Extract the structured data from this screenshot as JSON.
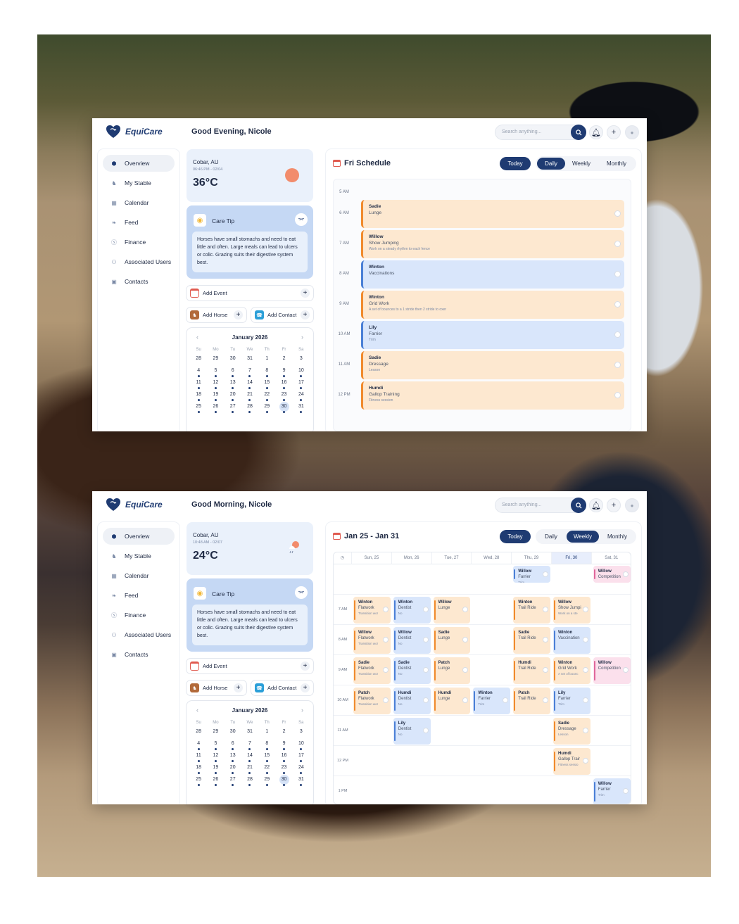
{
  "brand": {
    "name": "EquiCare"
  },
  "search": {
    "placeholder": "Search anything..."
  },
  "nav": [
    "Overview",
    "My Stable",
    "Calendar",
    "Feed",
    "Finance",
    "Associated Users",
    "Contacts"
  ],
  "care_tip": {
    "title": "Care Tip",
    "text": "Horses have small stomachs and need to eat little and often. Large meals can lead to ulcers or colic. Grazing suits their digestive system best."
  },
  "quick": {
    "add_event": "Add Event",
    "add_horse": "Add Horse",
    "add_contact": "Add Contact"
  },
  "mini_calendar": {
    "month": "January 2026",
    "weekdays": [
      "Su",
      "Mo",
      "Tu",
      "We",
      "Th",
      "Fr",
      "Sa"
    ],
    "days": [
      "28",
      "29",
      "30",
      "31",
      "1",
      "2",
      "3",
      "4",
      "5",
      "6",
      "7",
      "8",
      "9",
      "10",
      "11",
      "12",
      "13",
      "14",
      "15",
      "16",
      "17",
      "18",
      "19",
      "20",
      "21",
      "22",
      "23",
      "24",
      "25",
      "26",
      "27",
      "28",
      "29",
      "30",
      "31"
    ]
  },
  "view_buttons": {
    "today": "Today",
    "daily": "Daily",
    "weekly": "Weekly",
    "monthly": "Monthly"
  },
  "screen1": {
    "greeting": "Good Evening, Nicole",
    "weather": {
      "location": "Cobar, AU",
      "time": "06:46 PM - 02/04",
      "temp": "36°C"
    },
    "schedule_title": "Fri Schedule",
    "first_time": "5 AM",
    "events": [
      {
        "time": "6 AM",
        "name": "Sadie",
        "type": "Lunge",
        "note": "",
        "color": "orange"
      },
      {
        "time": "7 AM",
        "name": "Willow",
        "type": "Show Jumping",
        "note": "Work on a steady rhythm to each fence",
        "color": "orange"
      },
      {
        "time": "8 AM",
        "name": "Winton",
        "type": "Vaccinations",
        "note": "",
        "color": "blue"
      },
      {
        "time": "9 AM",
        "name": "Winton",
        "type": "Grid Work",
        "note": "A set of bounces to a 1 stride then 2 stride to oxer",
        "color": "orange"
      },
      {
        "time": "10 AM",
        "name": "Lily",
        "type": "Farrier",
        "note": "Trim",
        "color": "blue"
      },
      {
        "time": "11 AM",
        "name": "Sadie",
        "type": "Dressage",
        "note": "Lesson",
        "color": "orange"
      },
      {
        "time": "12 PM",
        "name": "Humdi",
        "type": "Gallop Training",
        "note": "Fitness session",
        "color": "orange"
      }
    ]
  },
  "screen2": {
    "greeting": "Good Morning, Nicole",
    "weather": {
      "location": "Cobar, AU",
      "time": "10:48 AM - 02/07",
      "temp": "24°C"
    },
    "schedule_title": "Jan 25 - Jan 31",
    "days": [
      "Sun, 25",
      "Mon, 26",
      "Tue, 27",
      "Wed, 28",
      "Thu, 29",
      "Fri, 30",
      "Sat, 31"
    ],
    "times": [
      "7 AM",
      "8 AM",
      "9 AM",
      "10 AM",
      "11 AM",
      "12 PM",
      "1 PM"
    ],
    "events": [
      {
        "row": 0,
        "col": 4,
        "name": "Willow",
        "type": "Farrier",
        "note": "Trim",
        "color": "blue"
      },
      {
        "row": 0,
        "col": 6,
        "name": "Willow",
        "type": "Competition",
        "note": "",
        "color": "pink"
      },
      {
        "row": 1,
        "col": 0,
        "name": "Winton",
        "type": "Flatwork",
        "note": "Transition wor",
        "color": "orange"
      },
      {
        "row": 1,
        "col": 1,
        "name": "Winton",
        "type": "Dentist",
        "note": "No",
        "color": "blue"
      },
      {
        "row": 1,
        "col": 2,
        "name": "Willow",
        "type": "Lunge",
        "note": "",
        "color": "orange"
      },
      {
        "row": 1,
        "col": 4,
        "name": "Winton",
        "type": "Trail Ride",
        "note": "",
        "color": "orange"
      },
      {
        "row": 1,
        "col": 5,
        "name": "Willow",
        "type": "Show Jumpi",
        "note": "Work on a ste",
        "color": "orange"
      },
      {
        "row": 2,
        "col": 0,
        "name": "Willow",
        "type": "Flatwork",
        "note": "Transition wor",
        "color": "orange"
      },
      {
        "row": 2,
        "col": 1,
        "name": "Willow",
        "type": "Dentist",
        "note": "No",
        "color": "blue"
      },
      {
        "row": 2,
        "col": 2,
        "name": "Sadie",
        "type": "Lunge",
        "note": "",
        "color": "orange"
      },
      {
        "row": 2,
        "col": 4,
        "name": "Sadie",
        "type": "Trail Ride",
        "note": "",
        "color": "orange"
      },
      {
        "row": 2,
        "col": 5,
        "name": "Winton",
        "type": "Vaccination",
        "note": "",
        "color": "blue"
      },
      {
        "row": 3,
        "col": 0,
        "name": "Sadie",
        "type": "Flatwork",
        "note": "Transition wor",
        "color": "orange"
      },
      {
        "row": 3,
        "col": 1,
        "name": "Sadie",
        "type": "Dentist",
        "note": "No",
        "color": "blue"
      },
      {
        "row": 3,
        "col": 2,
        "name": "Patch",
        "type": "Lunge",
        "note": "",
        "color": "orange"
      },
      {
        "row": 3,
        "col": 4,
        "name": "Humdi",
        "type": "Trail Ride",
        "note": "",
        "color": "orange"
      },
      {
        "row": 3,
        "col": 5,
        "name": "Winton",
        "type": "Grid Work",
        "note": "A set of bounc",
        "color": "orange"
      },
      {
        "row": 3,
        "col": 6,
        "name": "Willow",
        "type": "Competition",
        "note": "",
        "color": "pink"
      },
      {
        "row": 4,
        "col": 0,
        "name": "Patch",
        "type": "Flatwork",
        "note": "Transition wor",
        "color": "orange"
      },
      {
        "row": 4,
        "col": 1,
        "name": "Humdi",
        "type": "Dentist",
        "note": "No",
        "color": "blue"
      },
      {
        "row": 4,
        "col": 2,
        "name": "Humdi",
        "type": "Lunge",
        "note": "",
        "color": "orange"
      },
      {
        "row": 4,
        "col": 3,
        "name": "Winton",
        "type": "Farrier",
        "note": "Trim",
        "color": "blue"
      },
      {
        "row": 4,
        "col": 4,
        "name": "Patch",
        "type": "Trail Ride",
        "note": "",
        "color": "orange"
      },
      {
        "row": 4,
        "col": 5,
        "name": "Lily",
        "type": "Farrier",
        "note": "Trim",
        "color": "blue"
      },
      {
        "row": 5,
        "col": 1,
        "name": "Lily",
        "type": "Dentist",
        "note": "No",
        "color": "blue"
      },
      {
        "row": 5,
        "col": 5,
        "name": "Sadie",
        "type": "Dressage",
        "note": "Lesson",
        "color": "orange"
      },
      {
        "row": 6,
        "col": 5,
        "name": "Humdi",
        "type": "Gallop Trair",
        "note": "Fitness sessio",
        "color": "orange"
      },
      {
        "row": 7,
        "col": 6,
        "name": "Willow",
        "type": "Farrier",
        "note": "Trim",
        "color": "blue"
      }
    ]
  },
  "colors": {
    "primary": "#1f3b72",
    "orange": "#f08a2c",
    "blue": "#4a7fd6",
    "pink": "#e0669b",
    "sun": "#f28c6c"
  }
}
